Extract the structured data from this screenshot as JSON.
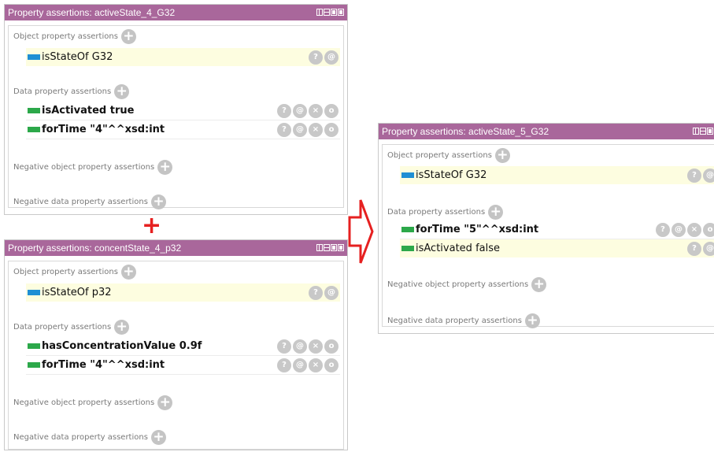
{
  "panels": [
    {
      "title": "Property assertions: activeState_4_G32",
      "object_section": "Object property assertions",
      "object_rows": [
        {
          "prop": "isStateOf",
          "value": "G32",
          "bold": false
        }
      ],
      "data_section": "Data property assertions",
      "data_rows": [
        {
          "prop": "isActivated",
          "value": "true",
          "bold": true
        },
        {
          "prop": "forTime",
          "value": "\"4\"^^xsd:int",
          "bold": true
        }
      ],
      "neg_object": "Negative object property assertions",
      "neg_data": "Negative data property assertions"
    },
    {
      "title": "Property assertions: concentState_4_p32",
      "object_section": "Object property assertions",
      "object_rows": [
        {
          "prop": "isStateOf",
          "value": "p32",
          "bold": false
        }
      ],
      "data_section": "Data property assertions",
      "data_rows": [
        {
          "prop": "hasConcentrationValue",
          "value": "0.9f",
          "bold": true
        },
        {
          "prop": "forTime",
          "value": "\"4\"^^xsd:int",
          "bold": true
        }
      ],
      "neg_object": "Negative object property assertions",
      "neg_data": "Negative data property assertions"
    },
    {
      "title": "Property assertions: activeState_5_G32",
      "object_section": "Object property assertions",
      "object_rows": [
        {
          "prop": "isStateOf",
          "value": "G32",
          "bold": false
        }
      ],
      "data_section": "Data property assertions",
      "data_rows": [
        {
          "prop": "forTime",
          "value": "\"5\"^^xsd:int",
          "bold": true
        },
        {
          "prop": "isActivated",
          "value": "false",
          "bold": false
        }
      ],
      "neg_object": "Negative object property assertions",
      "neg_data": "Negative data property assertions"
    }
  ],
  "symbols": {
    "plus": "+",
    "help_icon": "?",
    "annotate_icon": "@",
    "delete_icon": "×",
    "edit_icon": "o"
  },
  "colors": {
    "titlebar": "#a9679b",
    "object_swatch": "#1f8fd4",
    "data_swatch": "#2ca84a",
    "highlight_row": "#fdfde0",
    "plus_sign": "#e62020",
    "arrow": "#e62020"
  }
}
